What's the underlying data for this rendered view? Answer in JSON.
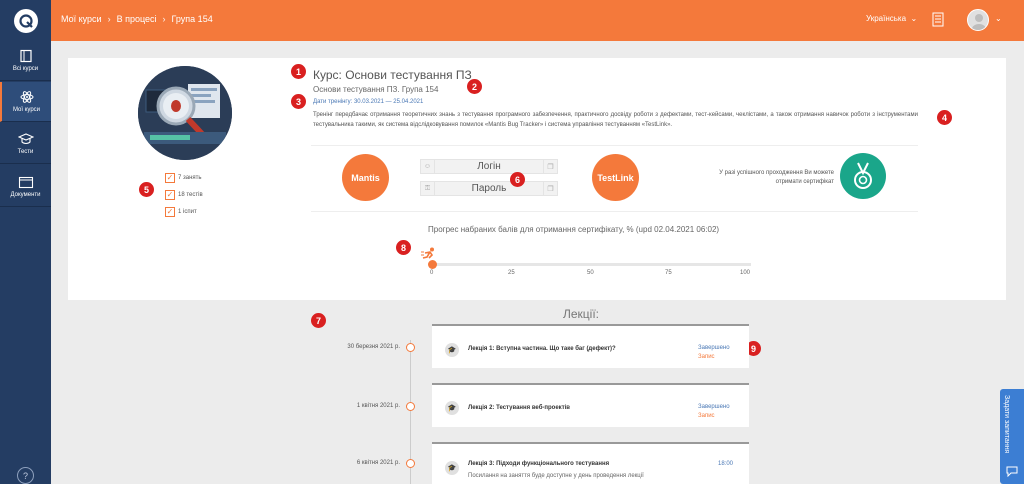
{
  "nav": {
    "items": [
      {
        "label": "Всі курси"
      },
      {
        "label": "Мої курси"
      },
      {
        "label": "Тести"
      },
      {
        "label": "Документи"
      }
    ],
    "help": "?"
  },
  "topbar": {
    "breadcrumbs": [
      "Мої курси",
      "В процесі",
      "Група 154"
    ],
    "language": "Українська"
  },
  "course": {
    "title": "Курс: Основи тестування ПЗ",
    "subtitle": "Основи тестування ПЗ. Група 154",
    "dates": "Дати тренінгу: 30.03.2021 — 25.04.2021",
    "description": "Тренінг передбачає отримання теоретичних знань з тестування програмного забезпечення, практичного досвіду роботи з дефектами, тест-кейсами, чеклістами, а також отримання навичок роботи з інструментами тестувальника такими, як система відслідковування помилок «Mantis Bug Tracker» і система управління тестуванням «TestLink».",
    "stats": [
      "7 занять",
      "18 тестів",
      "1 іспит"
    ]
  },
  "tools": {
    "mantis": "Mantis",
    "testlink": "TestLink",
    "login_label": "Логін",
    "password_label": "Пароль",
    "certificate_text": "У разі успішного проходження Ви можете отримати сертифікат"
  },
  "progress": {
    "label": "Прогрес набраних балів для отримання сертифікату, % (upd 02.04.2021 06:02)",
    "value": 0,
    "ticks": [
      "0",
      "25",
      "50",
      "75",
      "100"
    ]
  },
  "lectures": {
    "title": "Лекції:",
    "items": [
      {
        "date": "30 березня 2021 р.",
        "name": "Лекція 1: Вступна частина. Що таке баг (дефект)?",
        "status": "Завершено",
        "record": "Запис"
      },
      {
        "date": "1 квітня 2021 р.",
        "name": "Лекція 2: Тестування веб-проектів",
        "status": "Завершено",
        "record": "Запис"
      },
      {
        "date": "6 квітня 2021 р.",
        "name": "Лекція 3: Підходи функціонального тестування",
        "time": "18:00",
        "note": "Посилання на заняття буде доступне у день проведення лекції"
      }
    ]
  },
  "annotations": [
    "1",
    "2",
    "3",
    "4",
    "5",
    "6",
    "7",
    "8",
    "9"
  ],
  "ask_button": "Задати запитання",
  "colors": {
    "accent": "#f4793b",
    "sidebar": "#243d63",
    "certificate": "#1aa68a",
    "link": "#4a78b5",
    "marker": "#d92020"
  }
}
